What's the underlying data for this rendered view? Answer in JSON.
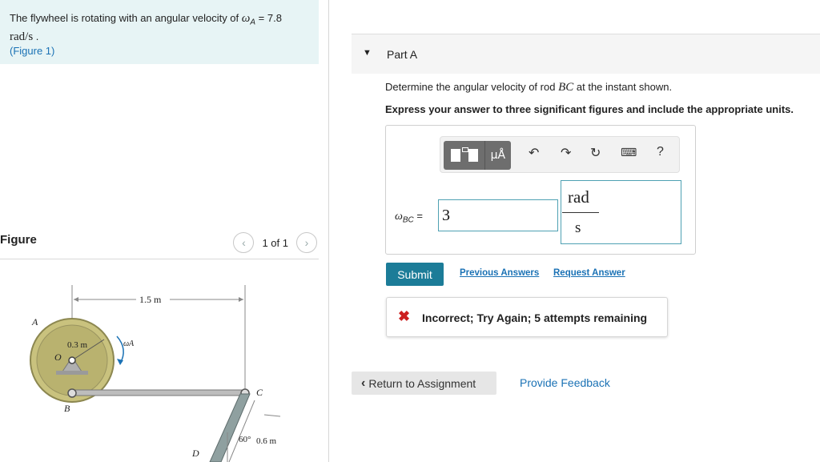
{
  "problem": {
    "text_prefix": "The flywheel is rotating with an angular velocity of",
    "omega": "ω",
    "omega_sub": "A",
    "equals_value": "= 7.8",
    "units": "rad/s",
    "period": ".",
    "figure_link": "(Figure 1)"
  },
  "figure_panel": {
    "title": "Figure",
    "pager_text": "1 of 1",
    "prev_icon": "chevron-left",
    "next_icon": "chevron-right",
    "labels": {
      "A": "A",
      "O": "O",
      "B": "B",
      "C": "C",
      "D": "D",
      "r": "0.3 m",
      "len": "1.5 m",
      "omega_a": "ωA",
      "angle": "60°",
      "bc": "0.6 m"
    }
  },
  "part": {
    "title": "Part A",
    "question_prefix": "Determine the angular velocity of rod",
    "rod": "BC",
    "question_suffix": "at the instant shown.",
    "instruction": "Express your answer to three significant figures and include the appropriate units."
  },
  "answer": {
    "toolbar": {
      "units_btn": "μÅ",
      "icons": [
        "templates-icon",
        "units-icon",
        "undo-icon",
        "redo-icon",
        "reset-icon",
        "keyboard-icon",
        "help-icon"
      ],
      "help_label": "?"
    },
    "omega_label": "ω",
    "omega_sub": "BC",
    "equals": "=",
    "value": "3",
    "unit_numerator": "rad",
    "unit_denominator": "s"
  },
  "actions": {
    "submit": "Submit",
    "previous_answers": "Previous Answers",
    "request_answer": "Request Answer"
  },
  "feedback": {
    "message": "Incorrect; Try Again; 5 attempts remaining",
    "status_color": "#cc1f1f"
  },
  "footer": {
    "return_label": "Return to Assignment",
    "provide_feedback": "Provide Feedback"
  },
  "colors": {
    "accent": "#1c7c98",
    "link": "#1b72b5",
    "problem_bg": "#e7f4f5"
  }
}
